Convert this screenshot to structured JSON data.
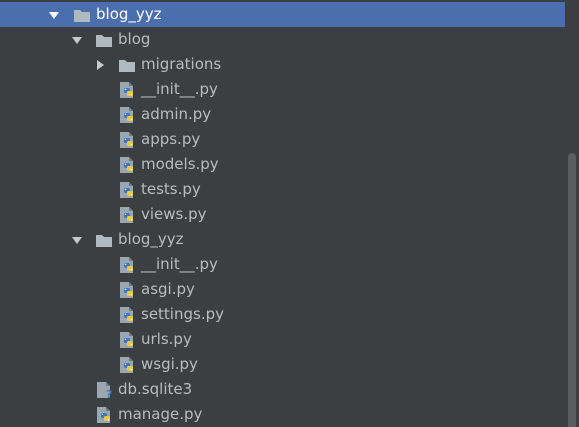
{
  "tree": {
    "items": [
      {
        "label": "blog_yyz",
        "type": "folder",
        "expanded": true,
        "selected": true
      },
      {
        "label": "blog",
        "type": "folder",
        "expanded": true
      },
      {
        "label": "migrations",
        "type": "folder",
        "expanded": false
      },
      {
        "label": "__init__.py",
        "type": "python-file"
      },
      {
        "label": "admin.py",
        "type": "python-file"
      },
      {
        "label": "apps.py",
        "type": "python-file"
      },
      {
        "label": "models.py",
        "type": "python-file"
      },
      {
        "label": "tests.py",
        "type": "python-file"
      },
      {
        "label": "views.py",
        "type": "python-file"
      },
      {
        "label": "blog_yyz",
        "type": "folder",
        "expanded": true
      },
      {
        "label": "__init__.py",
        "type": "python-file"
      },
      {
        "label": "asgi.py",
        "type": "python-file"
      },
      {
        "label": "settings.py",
        "type": "python-file"
      },
      {
        "label": "urls.py",
        "type": "python-file"
      },
      {
        "label": "wsgi.py",
        "type": "python-file"
      },
      {
        "label": "db.sqlite3",
        "type": "unknown-file"
      },
      {
        "label": "manage.py",
        "type": "python-file"
      }
    ]
  },
  "colors": {
    "background": "#3c3f41",
    "selection": "#4b6eaf",
    "text": "#bbbbbb",
    "folder": "#aeb9c0",
    "python_blue": "#3d7ab8",
    "python_yellow": "#e8c84a"
  }
}
